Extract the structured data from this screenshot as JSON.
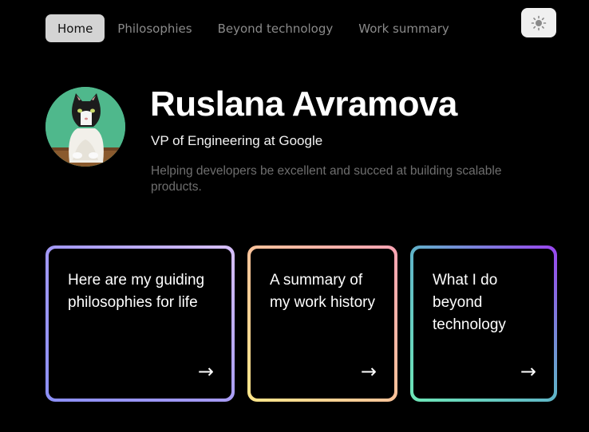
{
  "nav": {
    "items": [
      {
        "label": "Home",
        "active": true
      },
      {
        "label": "Philosophies",
        "active": false
      },
      {
        "label": "Beyond technology",
        "active": false
      },
      {
        "label": "Work summary",
        "active": false
      }
    ],
    "theme_toggle_icon": "sun-icon"
  },
  "hero": {
    "avatar_icon": "cat-avatar",
    "name": "Ruslana Avramova",
    "role": "VP of Engineering at Google",
    "tagline": "Helping developers be excellent and succed at building scalable products."
  },
  "cards": [
    {
      "title": "Here are my guiding philosophies for life",
      "arrow": "→"
    },
    {
      "title": "A summary of my work history",
      "arrow": "→"
    },
    {
      "title": "What I do beyond technology",
      "arrow": "→"
    }
  ],
  "colors": {
    "background": "#000000",
    "nav_active_bg": "#d4d4d4",
    "card1_gradient": [
      "#8b8ff7",
      "#d8c0fb"
    ],
    "card2_gradient": [
      "#fde68a",
      "#f9a3b4"
    ],
    "card3_gradient": [
      "#6ee7b7",
      "#9b44f0"
    ]
  }
}
